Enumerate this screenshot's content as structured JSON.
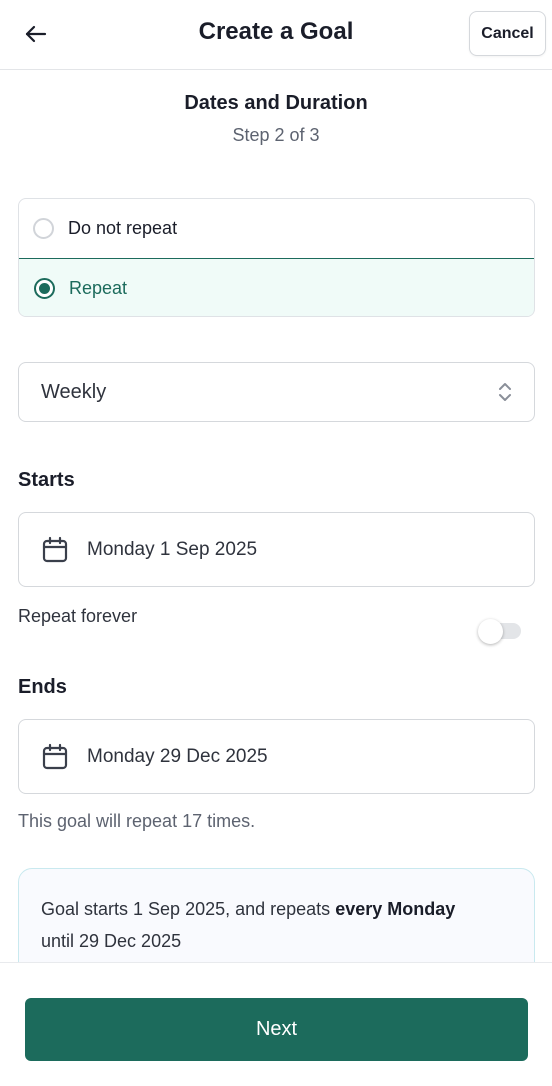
{
  "header": {
    "title": "Create a Goal",
    "cancel_label": "Cancel",
    "back_icon": "arrow-left-icon"
  },
  "section": {
    "title": "Dates and Duration",
    "step": "Step 2 of 3"
  },
  "repeat_options": {
    "items": [
      {
        "label": "Do not repeat",
        "selected": false
      },
      {
        "label": "Repeat",
        "selected": true
      }
    ],
    "accent_color": "#1c6b5c"
  },
  "frequency": {
    "value": "Weekly",
    "icon": "chevron-up-down-icon"
  },
  "starts": {
    "label": "Starts",
    "date": "Monday 1 Sep 2025",
    "icon": "calendar-icon"
  },
  "repeat_forever": {
    "label": "Repeat forever",
    "enabled": false
  },
  "ends": {
    "label": "Ends",
    "date": "Monday 29 Dec 2025",
    "icon": "calendar-icon"
  },
  "repeat_info": "This goal will repeat 17 times.",
  "summary": {
    "prefix": "Goal starts 1 Sep 2025, and repeats ",
    "emphasis": "every Monday",
    "suffix": "until 29 Dec 2025"
  },
  "footer": {
    "next_label": "Next"
  }
}
